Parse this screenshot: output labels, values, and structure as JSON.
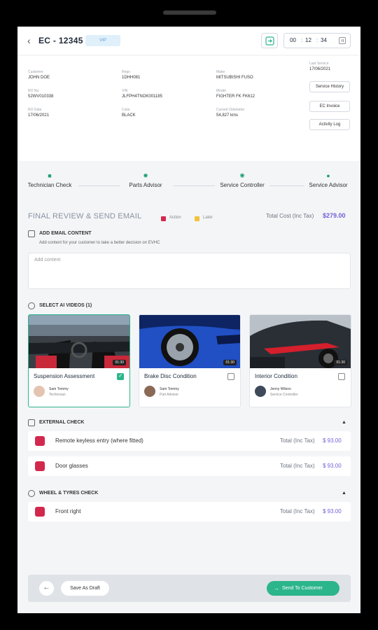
{
  "header": {
    "back_icon": "chevron-left-icon",
    "title": "EC - 12345",
    "badge": "VIP",
    "timer": {
      "hh": "00",
      "mm": "12",
      "ss": "34"
    }
  },
  "customer_info": {
    "fields": [
      {
        "label": "Customer",
        "value": "JOHN DOE"
      },
      {
        "label": "Rego",
        "value": "1DHH081"
      },
      {
        "label": "Make",
        "value": "MITSUBISHI FUSO"
      },
      {
        "label": "RO No.",
        "value": "52WV010338"
      },
      {
        "label": "VIN",
        "value": "JLFPH4TNOK001185"
      },
      {
        "label": "Model",
        "value": "FIGHTER FK FK612"
      },
      {
        "label": "RO Date",
        "value": "17/06/2021"
      },
      {
        "label": "Color",
        "value": "BLACK"
      },
      {
        "label": "Current Odometer",
        "value": "54,827 kms"
      }
    ],
    "last_service_label": "Last Service",
    "last_service_value": "17/06/2021",
    "buttons": [
      "Service History",
      "EC Invoice",
      "Activity Log"
    ]
  },
  "steps": [
    {
      "label": "Technician Check",
      "icon": "clipboard-icon"
    },
    {
      "label": "Parts Advisor",
      "icon": "gear-icon"
    },
    {
      "label": "Service Controller",
      "icon": "badge-icon"
    },
    {
      "label": "Service Advisor",
      "icon": "user-icon"
    }
  ],
  "legend": [
    {
      "label": "Action",
      "color": "#d3284d"
    },
    {
      "label": "Later",
      "color": "#f2c23a"
    }
  ],
  "final_review": {
    "title": "FINAL REVIEW & SEND EMAIL",
    "total_label": "Total Cost (Inc Tax)",
    "total_value": "$279.00"
  },
  "email_content": {
    "heading": "ADD EMAIL CONTENT",
    "subtitle": "Add content for your customer to take a better decision on EVHC",
    "placeholder": "Add content"
  },
  "videos": {
    "heading": "SELECT AI VIDEOS (1)",
    "items": [
      {
        "title": "Suspension Assessment",
        "duration": "01:30",
        "name": "Sam Tommy",
        "role": "Technician",
        "checked": true
      },
      {
        "title": "Brake Disc Condition",
        "duration": "01:30",
        "name": "Sam Tommy",
        "role": "Part Advisor",
        "checked": false
      },
      {
        "title": "Interior Condition",
        "duration": "01:30",
        "name": "Jenny Wilson",
        "role": "Service Controller",
        "checked": false
      }
    ]
  },
  "external_check": {
    "heading": "EXTERNAL CHECK",
    "rows": [
      {
        "name": "Remote keyless entry (where fitted)",
        "total_label": "Total (Inc Tax)",
        "price": "$ 93.00"
      },
      {
        "name": "Door glasses",
        "total_label": "Total (Inc Tax)",
        "price": "$ 93.00"
      }
    ]
  },
  "wheel_check": {
    "heading": "WHEEL & TYRES CHECK",
    "rows": [
      {
        "name": "Front right",
        "total_label": "Total (Inc Tax)",
        "price": "$ 93.00"
      }
    ]
  },
  "footer": {
    "save_draft": "Save As Draft",
    "send": "Send To Customer"
  }
}
